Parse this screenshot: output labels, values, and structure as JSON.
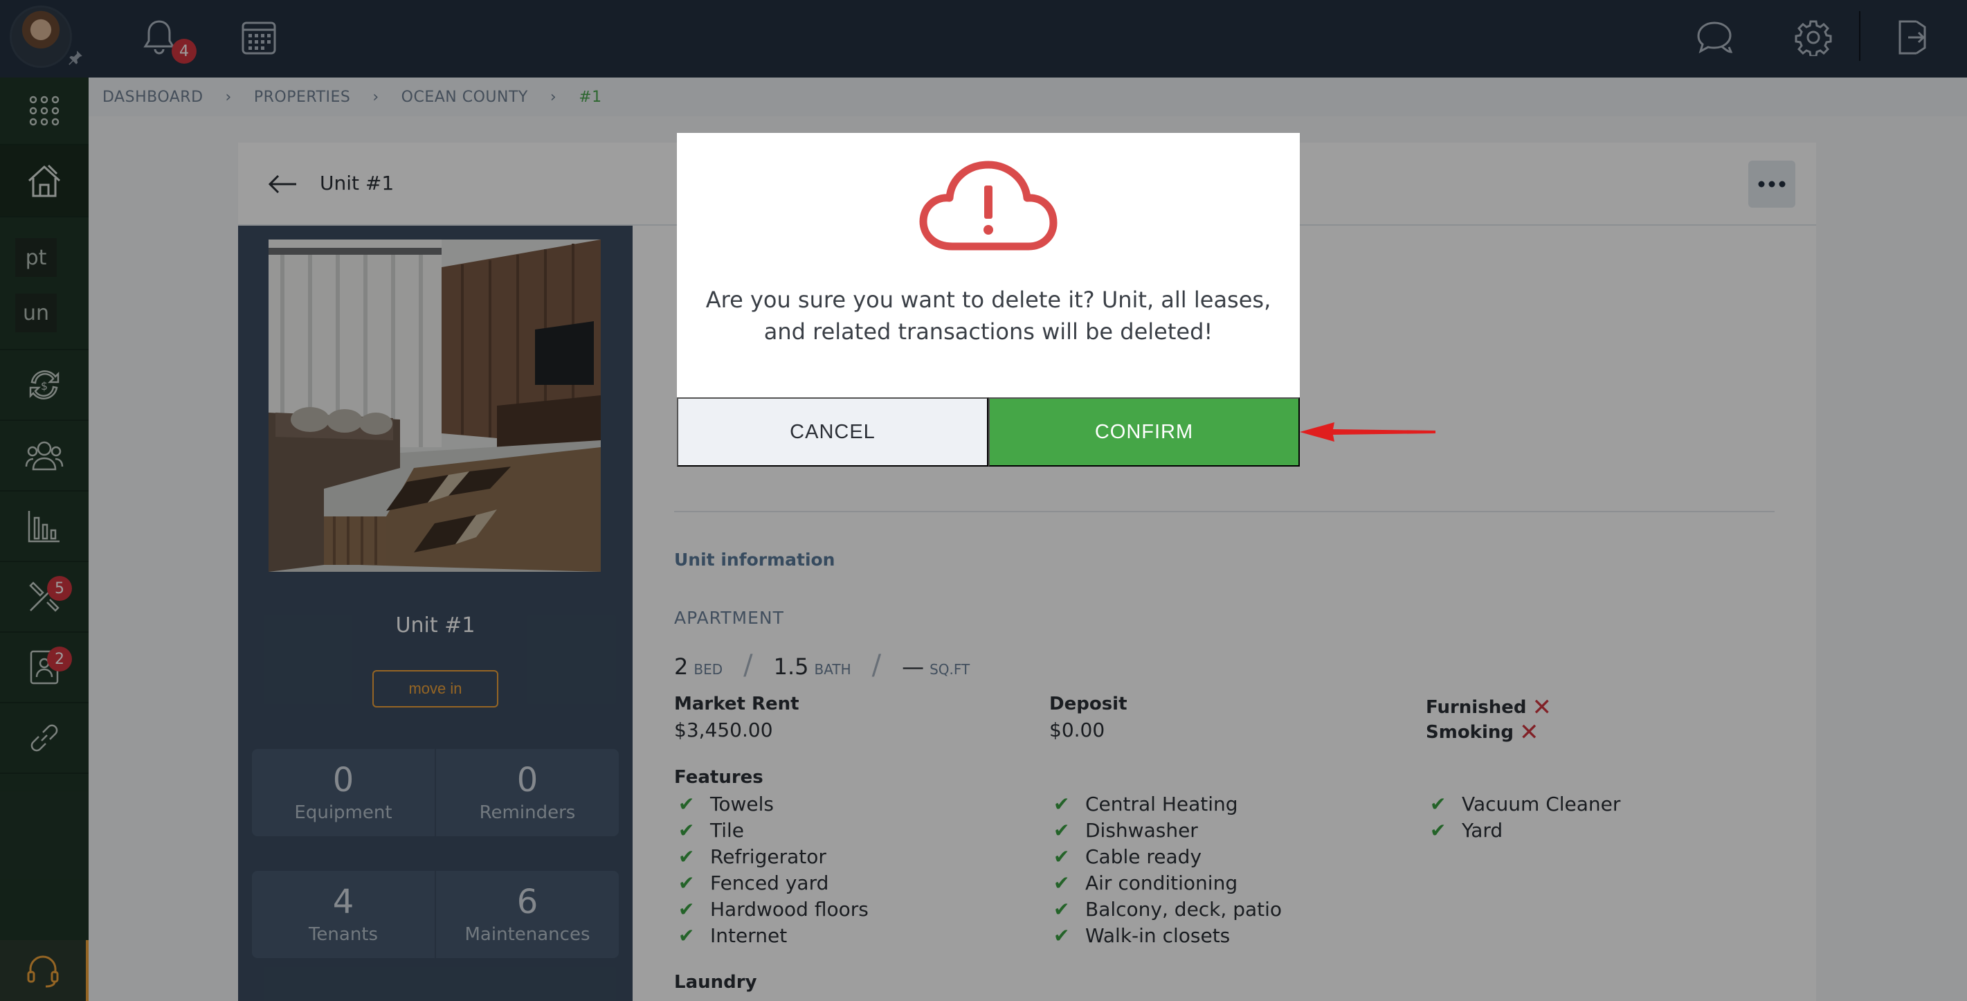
{
  "topbar": {
    "notifications_count": "4",
    "icons": [
      "avatar",
      "bell-icon",
      "calendar-icon",
      "chat-icon",
      "gear-icon",
      "logout-icon"
    ]
  },
  "sidebar": {
    "chip_pt": "pt",
    "chip_un": "un",
    "maintenance_badge": "5",
    "leases_badge": "2"
  },
  "breadcrumb": [
    "DASHBOARD",
    "PROPERTIES",
    "OCEAN COUNTY",
    "#1"
  ],
  "unit": {
    "title": "Unit #1",
    "name": "Unit #1",
    "move_in_label": "move in",
    "stats": [
      {
        "value": "0",
        "label": "Equipment"
      },
      {
        "value": "0",
        "label": "Reminders"
      },
      {
        "value": "4",
        "label": "Tenants"
      },
      {
        "value": "6",
        "label": "Maintenances"
      }
    ]
  },
  "details": {
    "section_title": "Unit information",
    "type": "APARTMENT",
    "bed": "2",
    "bed_label": "BED",
    "bath": "1.5",
    "bath_label": "BATH",
    "sqft": "—",
    "sqft_label": "SQ.FT",
    "market_rent_label": "Market Rent",
    "market_rent": "$3,450.00",
    "deposit_label": "Deposit",
    "deposit": "$0.00",
    "furnished_label": "Furnished",
    "smoking_label": "Smoking",
    "features_label": "Features",
    "features_col1": [
      "Towels",
      "Tile",
      "Refrigerator",
      "Fenced yard",
      "Hardwood floors",
      "Internet"
    ],
    "features_col2": [
      "Central Heating",
      "Dishwasher",
      "Cable ready",
      "Air conditioning",
      "Balcony, deck, patio",
      "Walk-in closets"
    ],
    "features_col3": [
      "Vacuum Cleaner",
      "Yard"
    ],
    "laundry_label": "Laundry"
  },
  "modal": {
    "message": "Are you sure you want to delete it? Unit, all leases, and related transactions will be deleted!",
    "cancel_label": "CANCEL",
    "confirm_label": "CONFIRM",
    "icon": "cloud-alert-icon"
  },
  "colors": {
    "topbar": "#243141",
    "sidebar": "#203628",
    "accent_green": "#45a647",
    "danger": "#d0363f",
    "move_in": "#f0a43b"
  }
}
